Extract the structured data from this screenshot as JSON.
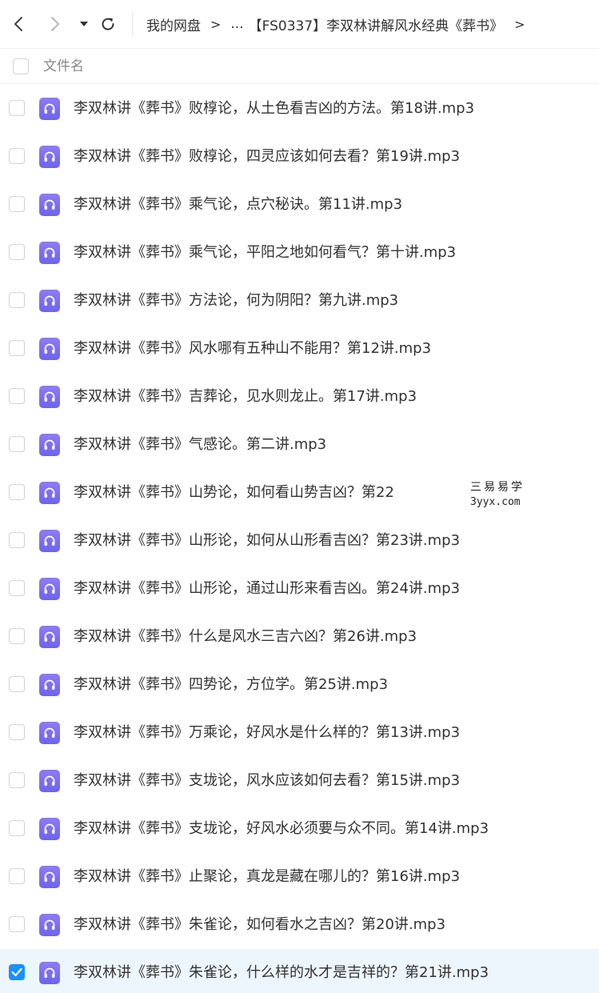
{
  "toolbar": {
    "back_icon": "chevron-left-icon",
    "forward_icon": "chevron-right-icon",
    "dropdown_icon": "caret-down-icon",
    "refresh_icon": "refresh-icon"
  },
  "breadcrumb": {
    "root": "我的网盘",
    "separator": ">",
    "ellipsis": "...",
    "current": "【FS0337】李双林讲解风水经典《葬书》",
    "trailing_separator": ">"
  },
  "list_header": {
    "column_name": "文件名"
  },
  "colors": {
    "accent": "#1890ff",
    "audio_icon": "#7b6ff2",
    "selected_row": "#eef6fd"
  },
  "files": [
    {
      "name": "李双林讲《葬书》败椁论，从土色看吉凶的方法。第18讲.mp3",
      "selected": false,
      "icon": "headphones-icon"
    },
    {
      "name": "李双林讲《葬书》败椁论，四灵应该如何去看？第19讲.mp3",
      "selected": false,
      "icon": "headphones-icon"
    },
    {
      "name": "李双林讲《葬书》乘气论，点穴秘诀。第11讲.mp3",
      "selected": false,
      "icon": "headphones-icon"
    },
    {
      "name": "李双林讲《葬书》乘气论，平阳之地如何看气？第十讲.mp3",
      "selected": false,
      "icon": "headphones-icon"
    },
    {
      "name": "李双林讲《葬书》方法论，何为阴阳？第九讲.mp3",
      "selected": false,
      "icon": "headphones-icon"
    },
    {
      "name": "李双林讲《葬书》风水哪有五种山不能用？第12讲.mp3",
      "selected": false,
      "icon": "headphones-icon"
    },
    {
      "name": "李双林讲《葬书》吉葬论，见水则龙止。第17讲.mp3",
      "selected": false,
      "icon": "headphones-icon"
    },
    {
      "name": "李双林讲《葬书》气感论。第二讲.mp3",
      "selected": false,
      "icon": "headphones-icon"
    },
    {
      "name": "李双林讲《葬书》山势论，如何看山势吉凶？第22",
      "selected": false,
      "icon": "headphones-icon"
    },
    {
      "name": "李双林讲《葬书》山形论，如何从山形看吉凶？第23讲.mp3",
      "selected": false,
      "icon": "headphones-icon"
    },
    {
      "name": "李双林讲《葬书》山形论，通过山形来看吉凶。第24讲.mp3",
      "selected": false,
      "icon": "headphones-icon"
    },
    {
      "name": "李双林讲《葬书》什么是风水三吉六凶？第26讲.mp3",
      "selected": false,
      "icon": "headphones-icon"
    },
    {
      "name": "李双林讲《葬书》四势论，方位学。第25讲.mp3",
      "selected": false,
      "icon": "headphones-icon"
    },
    {
      "name": "李双林讲《葬书》万乘论，好风水是什么样的？第13讲.mp3",
      "selected": false,
      "icon": "headphones-icon"
    },
    {
      "name": "李双林讲《葬书》支垅论，风水应该如何去看？第15讲.mp3",
      "selected": false,
      "icon": "headphones-icon"
    },
    {
      "name": "李双林讲《葬书》支垅论，好风水必须要与众不同。第14讲.mp3",
      "selected": false,
      "icon": "headphones-icon"
    },
    {
      "name": "李双林讲《葬书》止聚论，真龙是藏在哪儿的？第16讲.mp3",
      "selected": false,
      "icon": "headphones-icon"
    },
    {
      "name": "李双林讲《葬书》朱雀论，如何看水之吉凶？第20讲.mp3",
      "selected": false,
      "icon": "headphones-icon"
    },
    {
      "name": "李双林讲《葬书》朱雀论，什么样的水才是吉祥的？第21讲.mp3",
      "selected": true,
      "icon": "headphones-icon"
    }
  ],
  "watermark": {
    "text_cn": "三易易学",
    "url": "3yyx.com"
  }
}
